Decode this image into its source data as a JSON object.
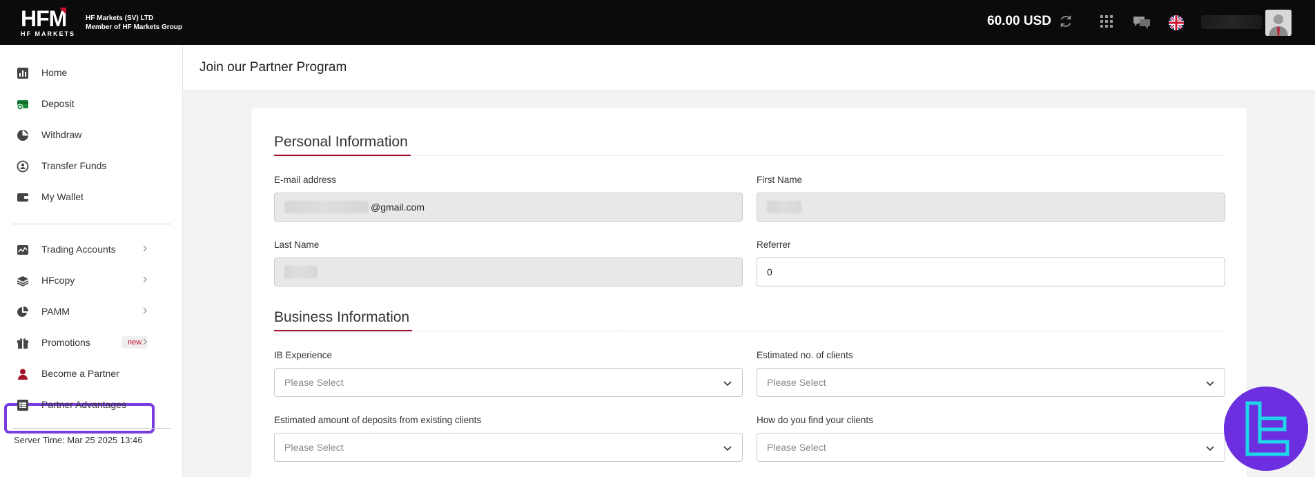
{
  "brand": {
    "logo_text": "HFM",
    "logo_sub": "HF MARKETS",
    "company_line1": "HF Markets (SV) LTD",
    "company_line2": "Member of HF Markets Group",
    "accent_color": "#a3112a"
  },
  "header": {
    "balance": "60.00 USD"
  },
  "sidebar": {
    "items": [
      {
        "label": "Home",
        "icon": "bar-chart-icon"
      },
      {
        "label": "Deposit",
        "icon": "deposit-icon"
      },
      {
        "label": "Withdraw",
        "icon": "withdraw-icon"
      },
      {
        "label": "Transfer Funds",
        "icon": "transfer-icon"
      },
      {
        "label": "My Wallet",
        "icon": "wallet-icon"
      },
      {
        "label": "Trading Accounts",
        "icon": "trading-chart-icon"
      },
      {
        "label": "HFcopy",
        "icon": "layers-icon"
      },
      {
        "label": "PAMM",
        "icon": "pie-chart-icon"
      },
      {
        "label": "Promotions",
        "icon": "gift-icon",
        "badge": "new"
      },
      {
        "label": "Become a Partner",
        "icon": "user-icon"
      },
      {
        "label": "Partner Advantages",
        "icon": "list-icon"
      }
    ],
    "server_time": "Server Time: Mar 25 2025 13:46",
    "highlight_color": "#7a3de0"
  },
  "main": {
    "page_title": "Join our Partner Program",
    "personal": {
      "title": "Personal Information",
      "email_label": "E-mail address",
      "email_value": "@gmail.com",
      "first_name_label": "First Name",
      "last_name_label": "Last Name",
      "referrer_label": "Referrer",
      "referrer_value": "0"
    },
    "business": {
      "title": "Business Information",
      "ib_experience_label": "IB Experience",
      "clients_label": "Estimated no. of clients",
      "deposits_label": "Estimated amount of deposits from existing clients",
      "find_clients_label": "How do you find your clients",
      "placeholder": "Please Select"
    }
  }
}
